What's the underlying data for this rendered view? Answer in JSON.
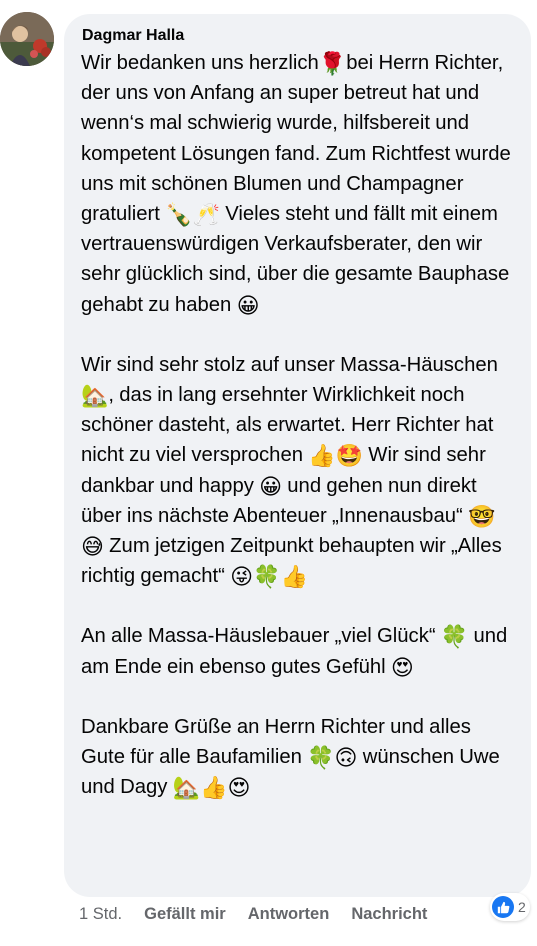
{
  "comment": {
    "author": "Dagmar Halla",
    "paragraphs": [
      {
        "segments": [
          {
            "t": "Wir bedanken uns herzlich"
          },
          {
            "e": "rose-icon",
            "g": "🌹"
          },
          {
            "t": "bei Herrn Richter, der uns von Anfang an super betreut hat und wenn‘s mal schwierig wurde, hilfsbereit und kompetent Lösungen fand. Zum Richtfest wurde uns mit schönen Blumen und Champagner gratuliert "
          },
          {
            "e": "champagne-bottle-icon",
            "g": "🍾"
          },
          {
            "e": "clinking-glasses-icon",
            "g": "🥂"
          },
          {
            "t": " Vieles steht und fällt mit einem vertrauenswürdigen Verkaufsberater, den wir sehr glücklich sind, über die gesamte Bauphase gehabt zu haben "
          },
          {
            "e": "grinning-face-icon",
            "g": "😀"
          }
        ]
      },
      {
        "segments": [
          {
            "t": "Wir sind sehr stolz auf unser Massa-Häuschen "
          },
          {
            "e": "house-with-garden-icon",
            "g": "🏡"
          },
          {
            "t": ", das in lang ersehnter Wirklichkeit noch schöner dasteht, als erwartet. Herr Richter hat nicht zu viel versprochen "
          },
          {
            "e": "thumbs-up-icon",
            "g": "👍"
          },
          {
            "e": "star-struck-icon",
            "g": "🤩"
          },
          {
            "t": " Wir sind sehr dankbar und happy "
          },
          {
            "e": "grinning-face-icon",
            "g": "😀"
          },
          {
            "t": " und gehen nun direkt über ins nächste Abenteuer „Innenausbau“ "
          },
          {
            "e": "nerd-face-icon",
            "g": "🤓"
          },
          {
            "t": " "
          },
          {
            "e": "grinning-sweat-icon",
            "g": "😅"
          },
          {
            "t": " Zum jetzigen Zeitpunkt behaupten wir „Alles richtig gemacht“ "
          },
          {
            "e": "winking-tongue-face-icon",
            "g": "😜"
          },
          {
            "e": "four-leaf-clover-icon",
            "g": "🍀"
          },
          {
            "e": "thumbs-up-icon",
            "g": "👍"
          }
        ]
      },
      {
        "segments": [
          {
            "t": "An alle Massa-Häuslebauer „viel Glück“ "
          },
          {
            "e": "four-leaf-clover-icon",
            "g": "🍀"
          },
          {
            "t": " und am Ende ein ebenso gutes Gefühl "
          },
          {
            "e": "heart-eyes-icon",
            "g": "😍"
          }
        ]
      },
      {
        "segments": [
          {
            "t": "Dankbare Grüße an Herrn Richter und alles Gute für alle Baufamilien "
          },
          {
            "e": "four-leaf-clover-icon",
            "g": "🍀"
          },
          {
            "e": "upside-down-face-icon",
            "g": "🙃"
          },
          {
            "t": " wünschen Uwe und Dagy "
          },
          {
            "e": "house-with-garden-icon",
            "g": "🏡"
          },
          {
            "e": "thumbs-up-icon",
            "g": "👍"
          },
          {
            "e": "heart-eyes-icon",
            "g": "😍"
          }
        ]
      }
    ],
    "bubble_color": "#f0f2f5",
    "avatar_icon": "profile-photo"
  },
  "actions": {
    "timestamp": "1 Std.",
    "like_label": "Gefällt mir",
    "reply_label": "Antworten",
    "message_label": "Nachricht"
  },
  "reactions": {
    "icon": "like-icon",
    "count": "2",
    "color": "#1877f2"
  }
}
